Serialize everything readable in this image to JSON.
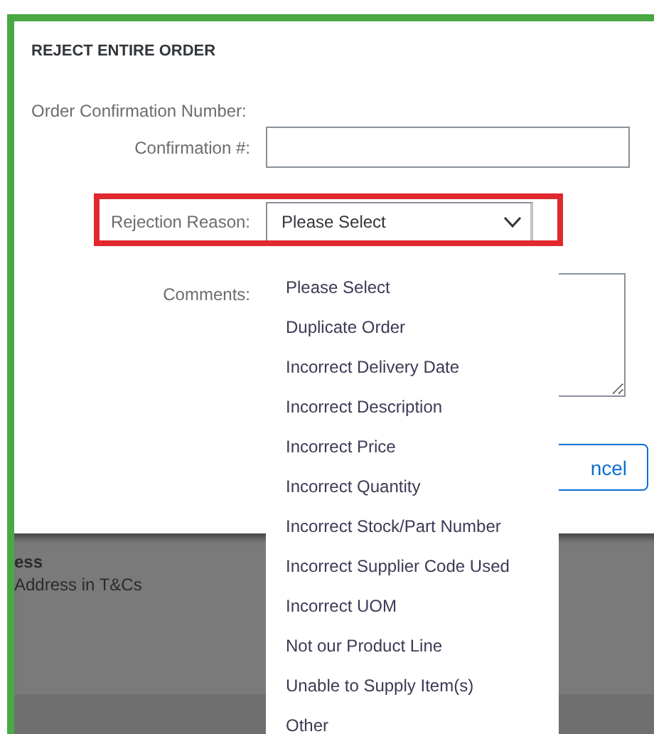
{
  "dialog": {
    "title": "REJECT ENTIRE ORDER",
    "section_label": "Order Confirmation Number:",
    "confirmation": {
      "label": "Confirmation #:"
    },
    "rejection_reason": {
      "label": "Rejection Reason:",
      "value": "Please Select",
      "expanded": true,
      "highlighted": true,
      "options": [
        "Please Select",
        "Duplicate Order",
        "Incorrect Delivery Date",
        "Incorrect Description",
        "Incorrect Price",
        "Incorrect Quantity",
        "Incorrect Stock/Part Number",
        "Incorrect Supplier Code Used",
        "Incorrect UOM",
        "Not our Product Line",
        "Unable to Supply Item(s)",
        "Other"
      ]
    },
    "comments": {
      "label": "Comments:"
    },
    "cancel_button": "ncel"
  },
  "background_page": {
    "heading": "ess",
    "text": "Address in T&Cs"
  }
}
